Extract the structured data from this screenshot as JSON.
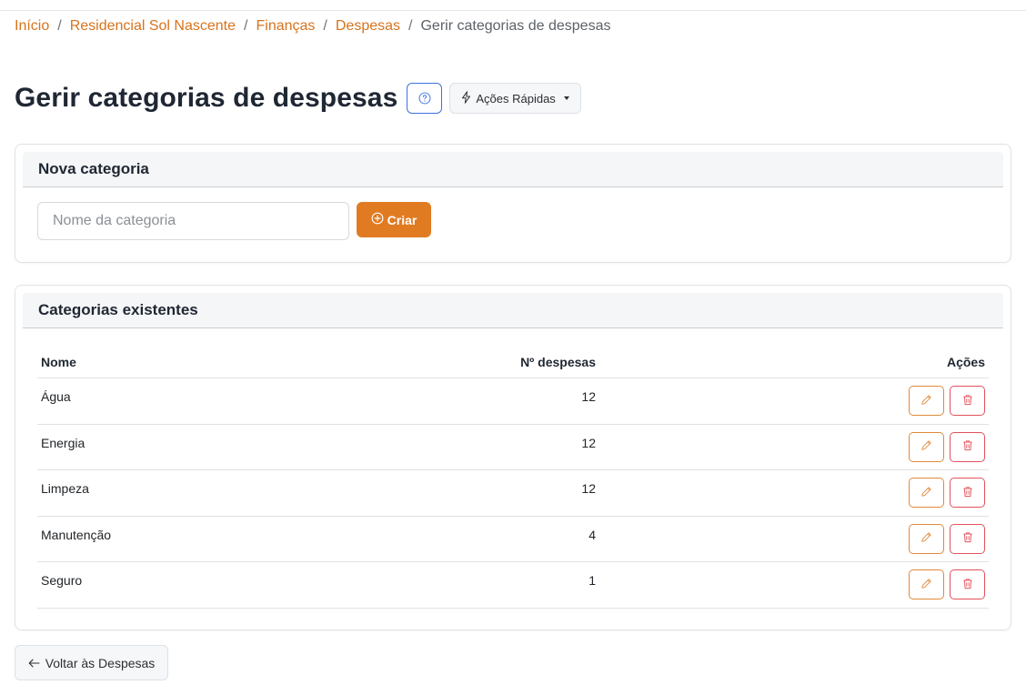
{
  "breadcrumb": {
    "items": [
      "Início",
      "Residencial Sol Nascente",
      "Finanças",
      "Despesas"
    ],
    "current": "Gerir categorias de despesas",
    "separator": "/"
  },
  "page": {
    "title": "Gerir categorias de despesas",
    "help_icon": "question-circle-icon",
    "quick_actions_label": "Ações Rápidas"
  },
  "new_category": {
    "title": "Nova categoria",
    "input_placeholder": "Nome da categoria",
    "input_value": "",
    "create_label": "Criar"
  },
  "categories": {
    "title": "Categorias existentes",
    "columns": {
      "name": "Nome",
      "count": "Nº despesas",
      "actions": "Ações"
    },
    "rows": [
      {
        "name": "Água",
        "count": "12"
      },
      {
        "name": "Energia",
        "count": "12"
      },
      {
        "name": "Limpeza",
        "count": "12"
      },
      {
        "name": "Manutenção",
        "count": "4"
      },
      {
        "name": "Seguro",
        "count": "1"
      }
    ]
  },
  "footer": {
    "back_label": "Voltar às Despesas"
  },
  "colors": {
    "accent": "#e17b22",
    "link": "#d7731d",
    "help_blue": "#3d73e0",
    "danger": "#e2525c"
  }
}
